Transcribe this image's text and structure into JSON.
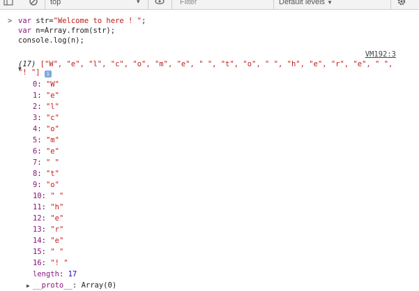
{
  "toolbar": {
    "context": "top",
    "filter_placeholder": "Filter",
    "levels": "Default levels"
  },
  "console": {
    "prompt": ">",
    "code": [
      {
        "parts": [
          {
            "t": "var",
            "c": "kw"
          },
          {
            "t": " str=",
            "c": ""
          },
          {
            "t": "\"Welcome to here ! \"",
            "c": "str"
          },
          {
            "t": ";",
            "c": ""
          }
        ]
      },
      {
        "parts": [
          {
            "t": "var",
            "c": "kw"
          },
          {
            "t": " n=Array.from(str);",
            "c": ""
          }
        ]
      },
      {
        "parts": [
          {
            "t": "console.log(n);",
            "c": ""
          }
        ]
      }
    ],
    "source_link": "VM192:3",
    "summary_count": "(17)",
    "summary_items": "[\"W\", \"e\", \"l\", \"c\", \"o\", \"m\", \"e\", \" \", \"t\", \"o\", \" \", \"h\", \"e\", \"r\", \"e\", \" \", \"! \"]",
    "info_badge": "i",
    "entries": [
      {
        "key": "0",
        "value": "\"W\""
      },
      {
        "key": "1",
        "value": "\"e\""
      },
      {
        "key": "2",
        "value": "\"l\""
      },
      {
        "key": "3",
        "value": "\"c\""
      },
      {
        "key": "4",
        "value": "\"o\""
      },
      {
        "key": "5",
        "value": "\"m\""
      },
      {
        "key": "6",
        "value": "\"e\""
      },
      {
        "key": "7",
        "value": "\" \""
      },
      {
        "key": "8",
        "value": "\"t\""
      },
      {
        "key": "9",
        "value": "\"o\""
      },
      {
        "key": "10",
        "value": "\" \""
      },
      {
        "key": "11",
        "value": "\"h\""
      },
      {
        "key": "12",
        "value": "\"e\""
      },
      {
        "key": "13",
        "value": "\"r\""
      },
      {
        "key": "14",
        "value": "\"e\""
      },
      {
        "key": "15",
        "value": "\" \""
      },
      {
        "key": "16",
        "value": "\"! \""
      }
    ],
    "length_key": "length",
    "length_value": "17",
    "proto_key": "__proto__",
    "proto_value": "Array(0)"
  }
}
